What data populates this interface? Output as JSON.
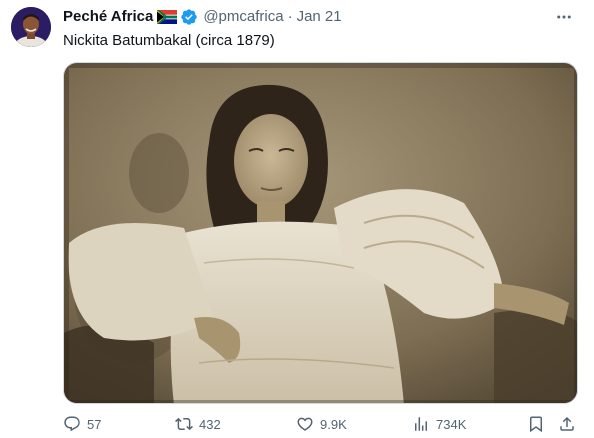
{
  "author": {
    "display_name": "Peché Africa",
    "handle": "@pmcafrica",
    "separator": "·",
    "date": "Jan 21"
  },
  "tweet": {
    "text": "Nickita Batumbakal (circa 1879)"
  },
  "actions": {
    "replies": "57",
    "reposts": "432",
    "likes": "9.9K",
    "views": "734K"
  },
  "colors": {
    "text_primary": "#0f1419",
    "text_secondary": "#536471",
    "verified_blue": "#1d9bf0",
    "border": "#cfd9de",
    "photo_sepia": "#8b7a5e"
  },
  "icons": {
    "country_flag": "south-africa-flag-icon",
    "verified": "verified-badge-icon",
    "more": "more-options-icon",
    "reply": "reply-icon",
    "repost": "repost-icon",
    "like": "heart-icon",
    "views": "views-icon",
    "bookmark": "bookmark-icon",
    "share": "share-icon"
  }
}
